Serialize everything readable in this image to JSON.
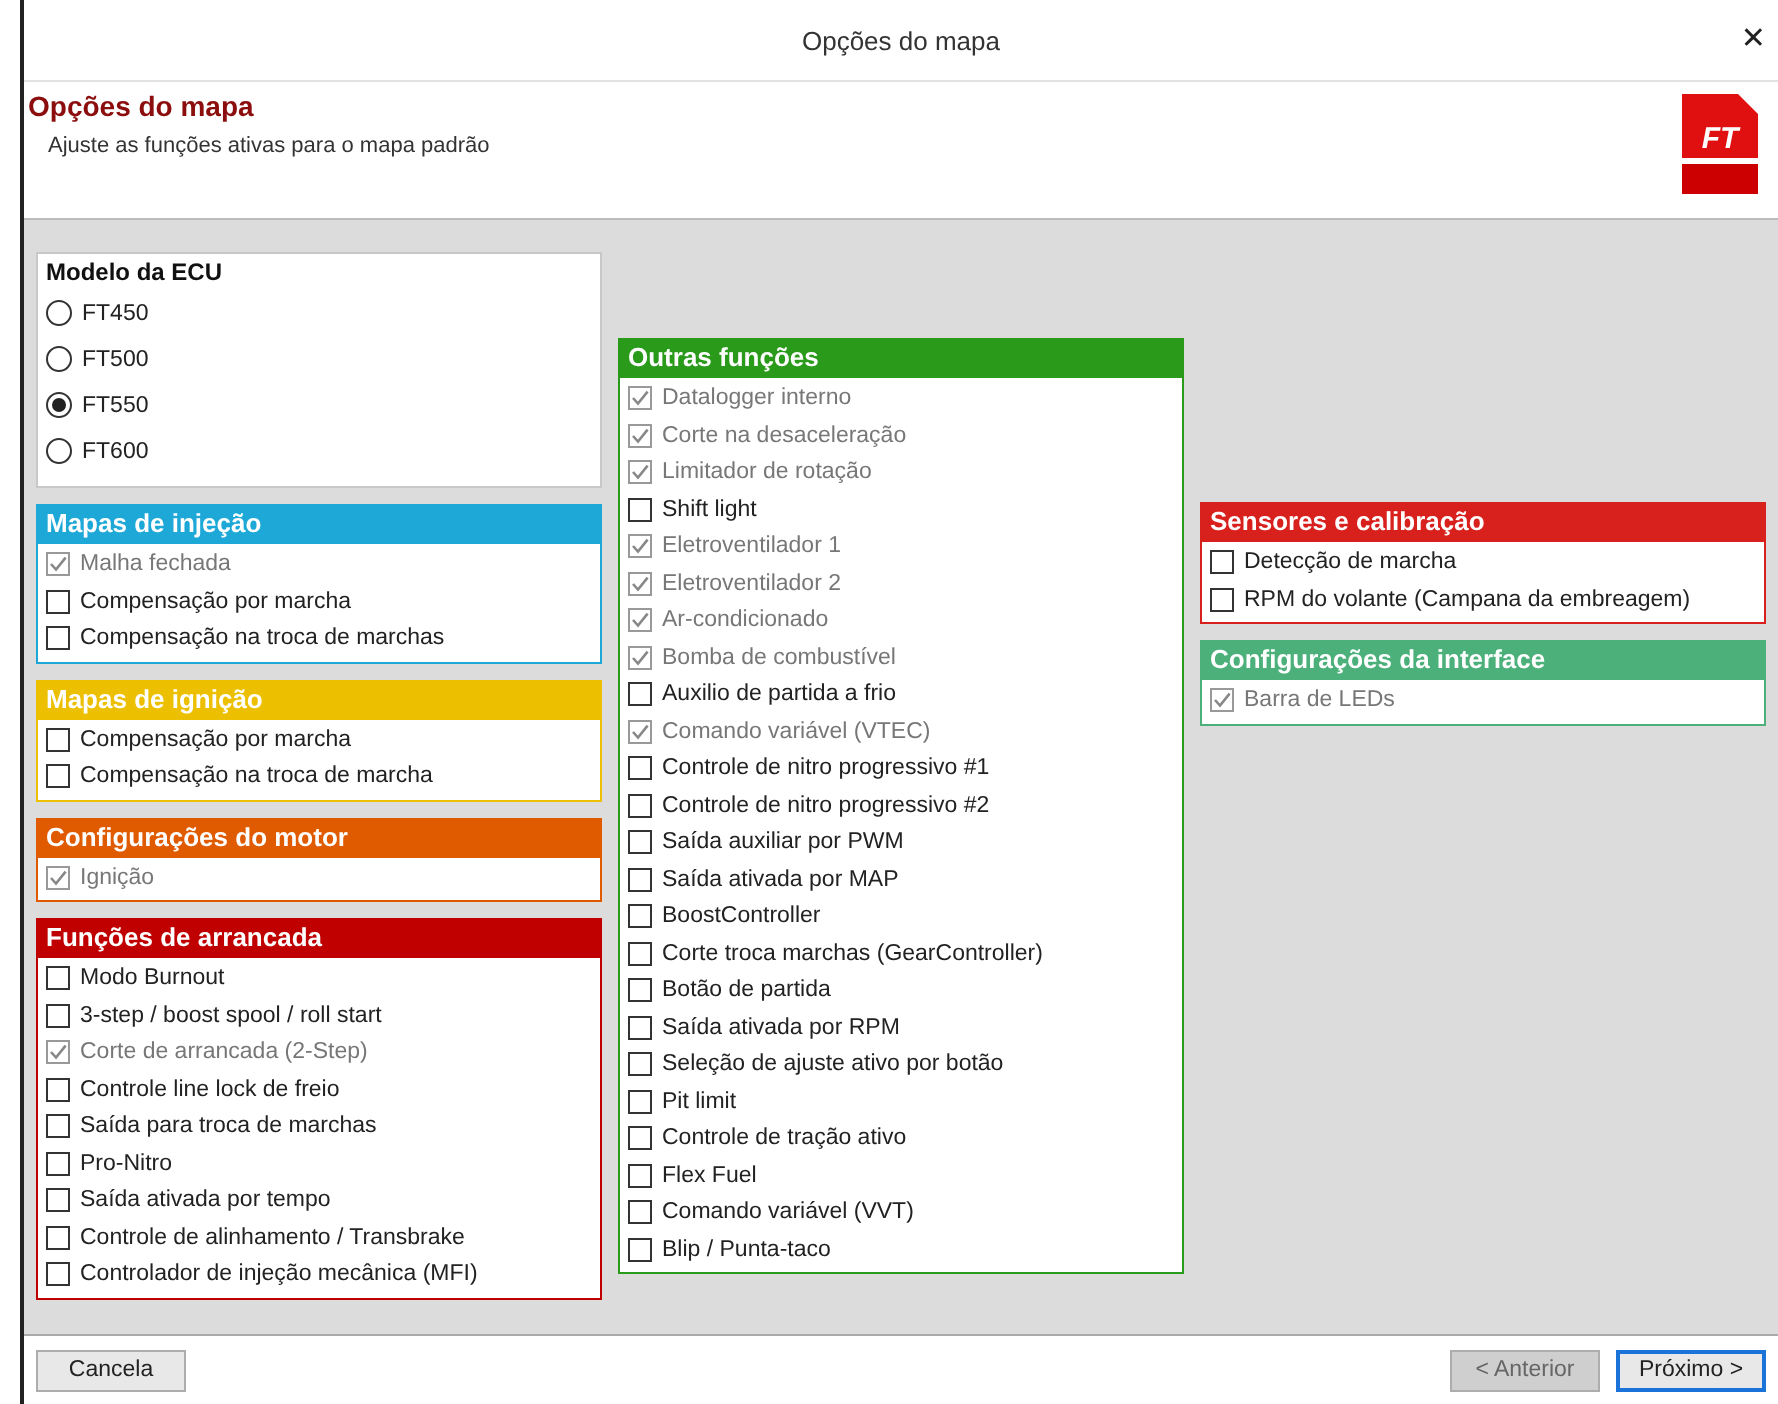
{
  "window": {
    "title": "Opções do mapa",
    "close": "✕"
  },
  "header": {
    "title": "Opções do mapa",
    "subtitle": "Ajuste as funções ativas para o mapa padrão",
    "logo_text": "FT"
  },
  "columns": [
    {
      "groups": [
        {
          "kind": "radio",
          "title": "Modelo da ECU",
          "items": [
            {
              "label": "FT450",
              "selected": false
            },
            {
              "label": "FT500",
              "selected": false
            },
            {
              "label": "FT550",
              "selected": true
            },
            {
              "label": "FT600",
              "selected": false
            }
          ]
        },
        {
          "kind": "checkbox",
          "title": "Mapas de injeção",
          "color": "#1ea8d8",
          "items": [
            {
              "label": "Malha fechada",
              "checked": true,
              "disabled": true
            },
            {
              "label": "Compensação por marcha",
              "checked": false,
              "disabled": false
            },
            {
              "label": "Compensação na troca de marchas",
              "checked": false,
              "disabled": false
            }
          ]
        },
        {
          "kind": "checkbox",
          "title": "Mapas de ignição",
          "color": "#ecc000",
          "items": [
            {
              "label": "Compensação por marcha",
              "checked": false,
              "disabled": false
            },
            {
              "label": "Compensação na troca de marcha",
              "checked": false,
              "disabled": false
            }
          ]
        },
        {
          "kind": "checkbox",
          "title": "Configurações do motor",
          "color": "#e05a00",
          "items": [
            {
              "label": "Ignição",
              "checked": true,
              "disabled": true
            }
          ]
        },
        {
          "kind": "checkbox",
          "title": "Funções de arrancada",
          "color": "#c00000",
          "items": [
            {
              "label": "Modo Burnout",
              "checked": false,
              "disabled": false
            },
            {
              "label": "3-step / boost spool / roll start",
              "checked": false,
              "disabled": false
            },
            {
              "label": "Corte de arrancada (2-Step)",
              "checked": true,
              "disabled": true
            },
            {
              "label": "Controle line lock de freio",
              "checked": false,
              "disabled": false
            },
            {
              "label": "Saída para troca de marchas",
              "checked": false,
              "disabled": false
            },
            {
              "label": "Pro-Nitro",
              "checked": false,
              "disabled": false
            },
            {
              "label": "Saída ativada por tempo",
              "checked": false,
              "disabled": false
            },
            {
              "label": "Controle de alinhamento / Transbrake",
              "checked": false,
              "disabled": false
            },
            {
              "label": "Controlador de injeção mecânica (MFI)",
              "checked": false,
              "disabled": false
            }
          ]
        }
      ]
    },
    {
      "groups": [
        {
          "kind": "checkbox",
          "title": "Outras funções",
          "color": "#2a9a1a",
          "items": [
            {
              "label": "Datalogger interno",
              "checked": true,
              "disabled": true
            },
            {
              "label": "Corte na desaceleração",
              "checked": true,
              "disabled": true
            },
            {
              "label": "Limitador de rotação",
              "checked": true,
              "disabled": true
            },
            {
              "label": "Shift light",
              "checked": false,
              "disabled": false
            },
            {
              "label": "Eletroventilador 1",
              "checked": true,
              "disabled": true
            },
            {
              "label": "Eletroventilador 2",
              "checked": true,
              "disabled": true
            },
            {
              "label": "Ar-condicionado",
              "checked": true,
              "disabled": true
            },
            {
              "label": "Bomba de combustível",
              "checked": true,
              "disabled": true
            },
            {
              "label": "Auxilio de partida a frio",
              "checked": false,
              "disabled": false
            },
            {
              "label": "Comando variável (VTEC)",
              "checked": true,
              "disabled": true
            },
            {
              "label": "Controle de nitro progressivo #1",
              "checked": false,
              "disabled": false
            },
            {
              "label": "Controle de nitro progressivo #2",
              "checked": false,
              "disabled": false
            },
            {
              "label": "Saída auxiliar por PWM",
              "checked": false,
              "disabled": false
            },
            {
              "label": "Saída ativada por MAP",
              "checked": false,
              "disabled": false
            },
            {
              "label": "BoostController",
              "checked": false,
              "disabled": false
            },
            {
              "label": "Corte troca marchas (GearController)",
              "checked": false,
              "disabled": false
            },
            {
              "label": "Botão de partida",
              "checked": false,
              "disabled": false
            },
            {
              "label": "Saída ativada por RPM",
              "checked": false,
              "disabled": false
            },
            {
              "label": "Seleção de ajuste ativo por botão",
              "checked": false,
              "disabled": false
            },
            {
              "label": "Pit limit",
              "checked": false,
              "disabled": false
            },
            {
              "label": "Controle de tração ativo",
              "checked": false,
              "disabled": false
            },
            {
              "label": "Flex Fuel",
              "checked": false,
              "disabled": false
            },
            {
              "label": "Comando variável (VVT)",
              "checked": false,
              "disabled": false
            },
            {
              "label": "Blip / Punta-taco",
              "checked": false,
              "disabled": false
            }
          ]
        }
      ]
    },
    {
      "groups": [
        {
          "kind": "checkbox",
          "title": "Sensores e calibração",
          "color": "#d8201c",
          "items": [
            {
              "label": "Detecção de marcha",
              "checked": false,
              "disabled": false
            },
            {
              "label": "RPM do volante (Campana da embreagem)",
              "checked": false,
              "disabled": false
            }
          ]
        },
        {
          "kind": "checkbox",
          "title": "Configurações da interface",
          "color": "#4cb07a",
          "items": [
            {
              "label": "Barra de LEDs",
              "checked": true,
              "disabled": true
            }
          ]
        }
      ]
    }
  ],
  "footer": {
    "buttons": [
      {
        "label": "Cancela",
        "disabled": false,
        "focused": false
      },
      {
        "label": "< Anterior",
        "disabled": true,
        "focused": false
      },
      {
        "label": "Próximo >",
        "disabled": false,
        "focused": true
      }
    ]
  }
}
